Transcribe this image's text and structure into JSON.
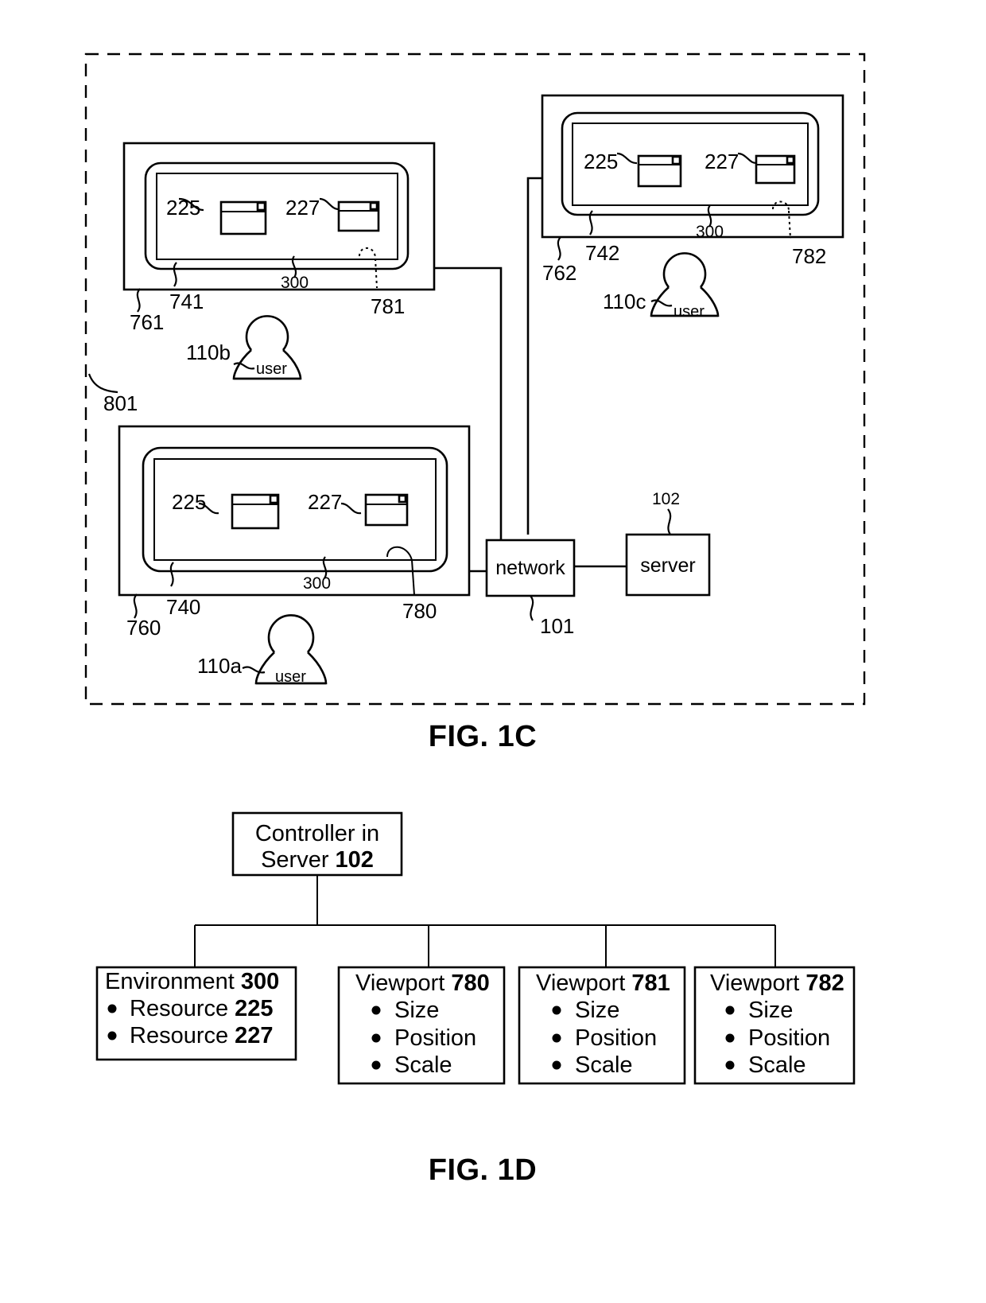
{
  "figures": [
    {
      "id": "fig-1c",
      "caption": "FIG. 1C",
      "boundary_ref": "801",
      "displays": [
        {
          "name": "display-b",
          "device_ref": "761",
          "screen_ref": "741",
          "environment_ref": "300",
          "viewport_ref": "781",
          "resources": [
            "225",
            "227"
          ],
          "user_ref": "110b",
          "user_label": "user"
        },
        {
          "name": "display-c",
          "device_ref": "762",
          "screen_ref": "742",
          "environment_ref": "300",
          "viewport_ref": "782",
          "resources": [
            "225",
            "227"
          ],
          "user_ref": "110c",
          "user_label": "user"
        },
        {
          "name": "display-a",
          "device_ref": "760",
          "screen_ref": "740",
          "environment_ref": "300",
          "viewport_ref": "780",
          "resources": [
            "225",
            "227"
          ],
          "user_ref": "110a",
          "user_label": "user"
        }
      ],
      "network": {
        "label": "network",
        "ref": "101"
      },
      "server": {
        "label": "server",
        "ref": "102"
      }
    },
    {
      "id": "fig-1d",
      "caption": "FIG. 1D",
      "root": {
        "line1": "Controller in",
        "line2_text": "Server ",
        "line2_ref": "102"
      },
      "children": [
        {
          "title_text": "Environment ",
          "title_ref": "300",
          "items": [
            "Resource 225",
            "Resource 227"
          ],
          "items_split": [
            {
              "text": "Resource ",
              "ref": "225"
            },
            {
              "text": "Resource ",
              "ref": "227"
            }
          ]
        },
        {
          "title_text": "Viewport ",
          "title_ref": "780",
          "items": [
            "Size",
            "Position",
            "Scale"
          ],
          "items_split": [
            {
              "text": "Size",
              "ref": ""
            },
            {
              "text": "Position",
              "ref": ""
            },
            {
              "text": "Scale",
              "ref": ""
            }
          ]
        },
        {
          "title_text": "Viewport ",
          "title_ref": "781",
          "items": [
            "Size",
            "Position",
            "Scale"
          ],
          "items_split": [
            {
              "text": "Size",
              "ref": ""
            },
            {
              "text": "Position",
              "ref": ""
            },
            {
              "text": "Scale",
              "ref": ""
            }
          ]
        },
        {
          "title_text": "Viewport ",
          "title_ref": "782",
          "items": [
            "Size",
            "Position",
            "Scale"
          ],
          "items_split": [
            {
              "text": "Size",
              "ref": ""
            },
            {
              "text": "Position",
              "ref": ""
            },
            {
              "text": "Scale",
              "ref": ""
            }
          ]
        }
      ]
    }
  ],
  "labels": {
    "ref_801": "801",
    "ref_761": "761",
    "ref_741": "741",
    "ref_300_b": "300",
    "ref_781": "781",
    "ref_110b": "110b",
    "ref_225_b": "225",
    "ref_227_b": "227",
    "user_b": "user",
    "ref_762": "762",
    "ref_742": "742",
    "ref_300_c": "300",
    "ref_782": "782",
    "ref_110c": "110c",
    "ref_225_c": "225",
    "ref_227_c": "227",
    "user_c": "user",
    "ref_760": "760",
    "ref_740": "740",
    "ref_300_a": "300",
    "ref_780": "780",
    "ref_110a": "110a",
    "ref_225_a": "225",
    "ref_227_a": "227",
    "user_a": "user",
    "network_label": "network",
    "ref_101": "101",
    "server_label": "server",
    "ref_102": "102",
    "fig_1c": "FIG. 1C",
    "fig_1d": "FIG. 1D",
    "d_root_l1": "Controller in",
    "d_root_l2": "Server ",
    "d_root_l2b": "102",
    "d_b1_title": "Environment ",
    "d_b1_title_b": "300",
    "d_b1_i1": "Resource ",
    "d_b1_i1b": "225",
    "d_b1_i2": "Resource ",
    "d_b1_i2b": "227",
    "d_b2_title": "Viewport ",
    "d_b2_title_b": "780",
    "d_b2_i1": "Size",
    "d_b2_i2": "Position",
    "d_b2_i3": "Scale",
    "d_b3_title": "Viewport ",
    "d_b3_title_b": "781",
    "d_b3_i1": "Size",
    "d_b3_i2": "Position",
    "d_b3_i3": "Scale",
    "d_b4_title": "Viewport ",
    "d_b4_title_b": "782",
    "d_b4_i1": "Size",
    "d_b4_i2": "Position",
    "d_b4_i3": "Scale"
  },
  "colors": {
    "ink": "#000000",
    "paper": "#ffffff"
  }
}
